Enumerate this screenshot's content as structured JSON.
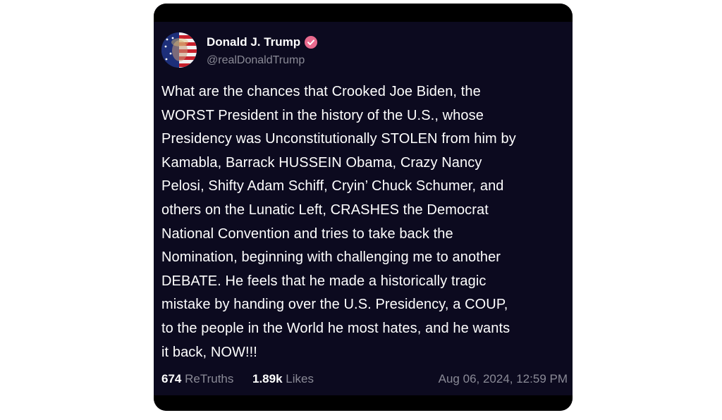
{
  "post": {
    "author_name": "Donald J. Trump",
    "author_handle": "@realDonaldTrump",
    "text": "What are the chances that Crooked Joe Biden, the\nWORST President in the history of the U.S., whose\nPresidency was Unconstitutionally STOLEN from him by\nKamabla, Barrack HUSSEIN Obama, Crazy Nancy\nPelosi, Shifty Adam Schiff, Cryin’ Chuck Schumer, and\nothers on the Lunatic Left, CRASHES the Democrat\nNational Convention and tries to take back the\nNomination, beginning with challenging me to another\nDEBATE. He feels that he made a historically tragic\nmistake by handing over the U.S. Presidency, a COUP,\nto the people in the World he most hates, and he wants\nit back, NOW!!!",
    "retruths_count": "674",
    "retruths_label": "ReTruths",
    "likes_count": "1.89k",
    "likes_label": "Likes",
    "timestamp": "Aug 06, 2024, 12:59 PM"
  },
  "icons": {
    "avatar": "avatar-flag-portrait",
    "verified": "verified-badge-icon"
  },
  "colors": {
    "card_background": "#0c0a1f",
    "verified_badge": "#e96a8e",
    "muted_text": "#8a8a96",
    "text": "#ffffff"
  }
}
